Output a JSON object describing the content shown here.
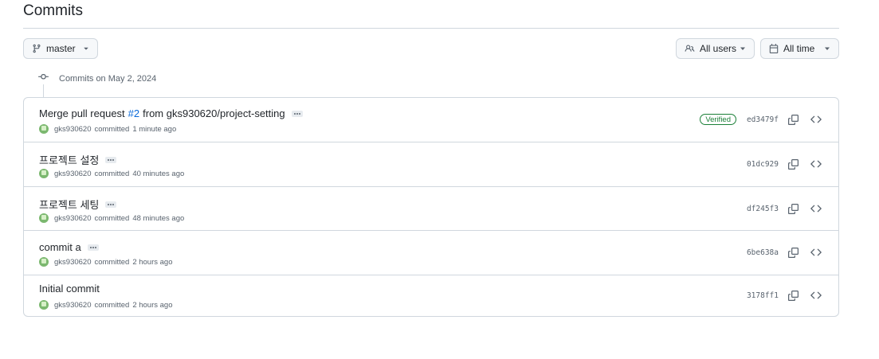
{
  "page_title": "Commits",
  "toolbar": {
    "branch_label": "master",
    "users_label": "All users",
    "time_label": "All time"
  },
  "timeline": {
    "heading": "Commits on May 2, 2024"
  },
  "commits": [
    {
      "message_pre": "Merge pull request",
      "pr_link": "#2",
      "message_post": "from gks930620/project-setting",
      "author": "gks930620",
      "action": "committed",
      "time": "1 minute ago",
      "verified": "Verified",
      "sha": "ed3479f",
      "has_ellipsis": true
    },
    {
      "message_pre": "프로젝트 설정",
      "author": "gks930620",
      "action": "committed",
      "time": "40 minutes ago",
      "sha": "01dc929",
      "has_ellipsis": true
    },
    {
      "message_pre": "프로젝트 세팅",
      "author": "gks930620",
      "action": "committed",
      "time": "48 minutes ago",
      "sha": "df245f3",
      "has_ellipsis": true
    },
    {
      "message_pre": "commit a",
      "author": "gks930620",
      "action": "committed",
      "time": "2 hours ago",
      "sha": "6be638a",
      "has_ellipsis": true
    },
    {
      "message_pre": "Initial commit",
      "author": "gks930620",
      "action": "committed",
      "time": "2 hours ago",
      "sha": "3178ff1",
      "has_ellipsis": false
    }
  ],
  "icons": {
    "branch": "git-branch-icon",
    "users": "people-icon",
    "calendar": "calendar-icon",
    "commit": "git-commit-icon",
    "copy": "copy-icon",
    "browse": "code-icon",
    "caret": "triangle-down-icon"
  },
  "colors": {
    "link": "#0969da",
    "verified": "#1a7f37",
    "border": "#d0d7de",
    "muted": "#59636e"
  }
}
